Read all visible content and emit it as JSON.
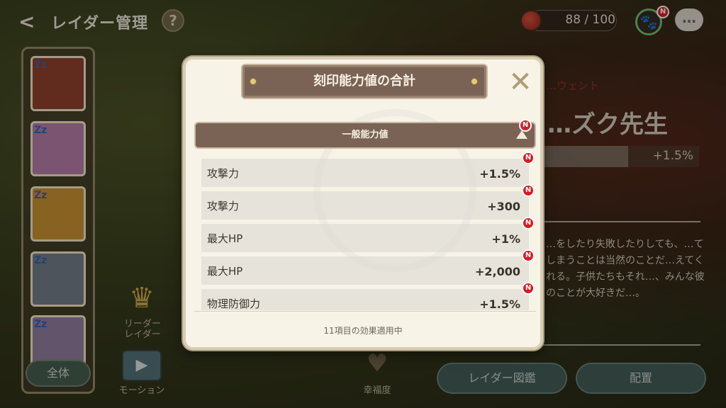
{
  "topbar": {
    "title": "レイダー管理",
    "back_icon": "back-arrow-icon",
    "help_label": "?",
    "stamina": "88 / 100",
    "badge": "N"
  },
  "left_panel": {
    "all_button": "全体",
    "leader_label": "リーダー\nレイダー",
    "motion_label": "モーション",
    "happiness_label": "幸福度"
  },
  "character": {
    "subtitle": "…ウェント",
    "name": "…ズク先生",
    "stat_value": "+1.5%",
    "description": "…をしたり失敗したりしても、…てしまうことは当然のことだ…えてくれる。子供たちもそれ…、みんな彼のことが大好きだ…。"
  },
  "bottom_buttons": {
    "raider_book": "レイダー図鑑",
    "deploy": "配置"
  },
  "modal": {
    "title": "刻印能力値の合計",
    "section_title": "一般能力値",
    "badge": "N",
    "rows": [
      {
        "name": "攻撃力",
        "value": "+1.5%"
      },
      {
        "name": "攻撃力",
        "value": "+300"
      },
      {
        "name": "最大HP",
        "value": "+1%"
      },
      {
        "name": "最大HP",
        "value": "+2,000"
      },
      {
        "name": "物理防御力",
        "value": "+1.5%"
      }
    ],
    "footer": "11項目の効果適用中"
  },
  "colors": {
    "header_brown": "#7a6354",
    "modal_bg": "#f7f3e7",
    "badge_red": "#d81d25"
  }
}
